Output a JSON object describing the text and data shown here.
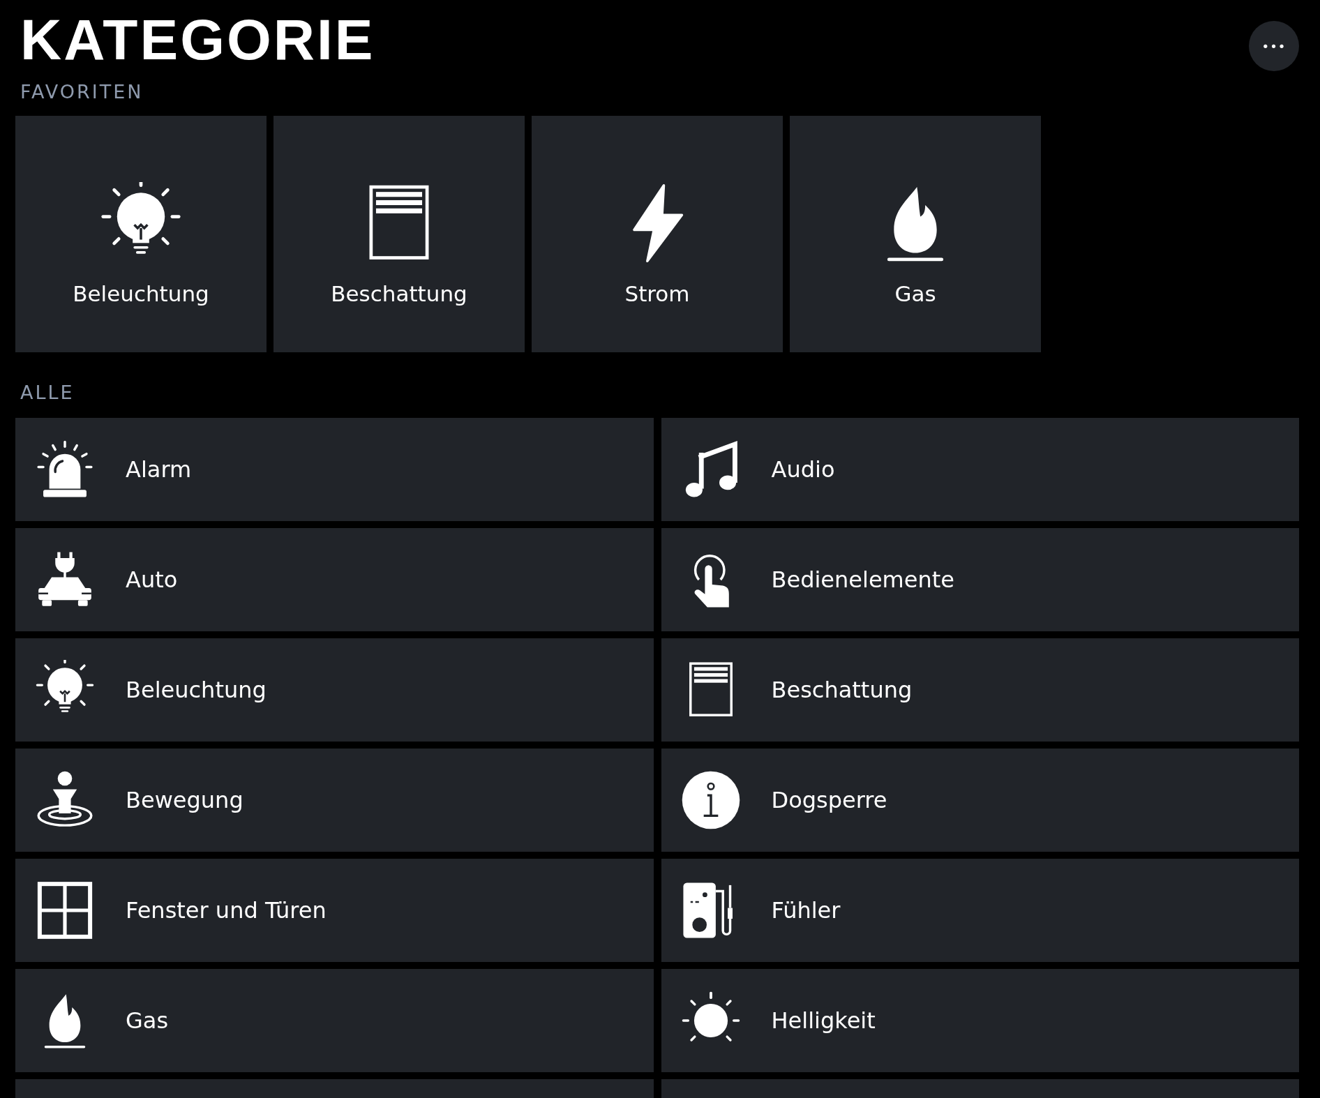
{
  "title": "KATEGORIE",
  "menu_button": {
    "label": "•••"
  },
  "favorites": {
    "heading": "FAVORITEN",
    "items": [
      {
        "label": "Beleuchtung",
        "kind": "bulb"
      },
      {
        "label": "Beschattung",
        "kind": "blind"
      },
      {
        "label": "Strom",
        "kind": "bolt"
      },
      {
        "label": "Gas",
        "kind": "flame"
      }
    ]
  },
  "all": {
    "heading": "ALLE",
    "items": [
      {
        "label": "Alarm",
        "kind": "siren"
      },
      {
        "label": "Audio",
        "kind": "note"
      },
      {
        "label": "Auto",
        "kind": "car"
      },
      {
        "label": "Bedienelemente",
        "kind": "touch"
      },
      {
        "label": "Beleuchtung",
        "kind": "bulb"
      },
      {
        "label": "Beschattung",
        "kind": "blind"
      },
      {
        "label": "Bewegung",
        "kind": "motion"
      },
      {
        "label": "Dogsperre",
        "kind": "info"
      },
      {
        "label": "Fenster und Türen",
        "kind": "window"
      },
      {
        "label": "Fühler",
        "kind": "sensor"
      },
      {
        "label": "Gas",
        "kind": "flame"
      },
      {
        "label": "Helligkeit",
        "kind": "sun"
      }
    ]
  }
}
